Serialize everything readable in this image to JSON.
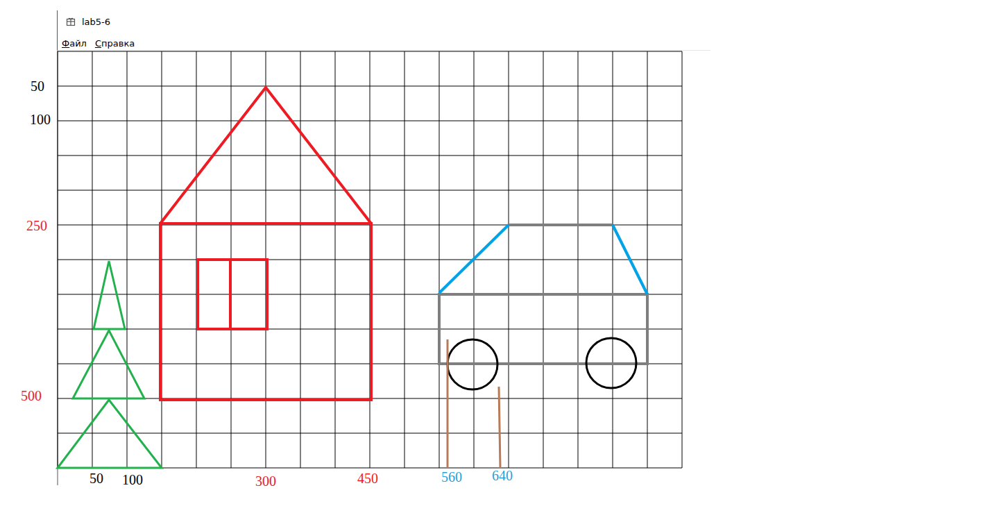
{
  "window": {
    "title": "lab5-6"
  },
  "menu": [
    {
      "label": "Файл"
    },
    {
      "label": "Справка"
    }
  ],
  "axis_labels": {
    "y": [
      {
        "text": "50",
        "color": "#000000"
      },
      {
        "text": "100",
        "color": "#000000"
      },
      {
        "text": "250",
        "color": "#ed1c24"
      },
      {
        "text": "500",
        "color": "#ed1c24"
      }
    ],
    "x": [
      {
        "text": "50",
        "color": "#000000"
      },
      {
        "text": "100",
        "color": "#000000"
      },
      {
        "text": "300",
        "color": "#ed1c24"
      },
      {
        "text": "450",
        "color": "#ed1c24"
      },
      {
        "text": "560",
        "color": "#2a9fd8"
      },
      {
        "text": "640",
        "color": "#2a9fd8"
      }
    ]
  },
  "figures": [
    {
      "name": "tree",
      "color": "#22b14c"
    },
    {
      "name": "house",
      "color": "#ed1c24"
    },
    {
      "name": "car-body",
      "color": "#7f7f7f"
    },
    {
      "name": "car-windows",
      "color": "#00a2e8"
    },
    {
      "name": "wheels",
      "color": "#000000"
    },
    {
      "name": "posts",
      "color": "#b97a57"
    }
  ]
}
